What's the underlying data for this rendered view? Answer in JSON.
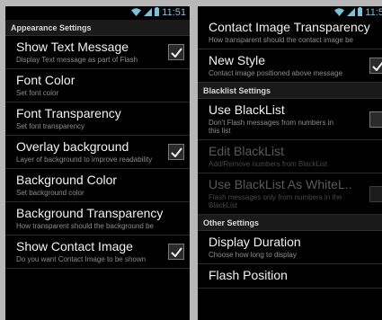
{
  "status_left": {
    "time": "11:51"
  },
  "status_right": {
    "time": "11:5"
  },
  "left_panel": {
    "section": "Appearance Settings",
    "prefs": [
      {
        "title": "Show Text Message",
        "summary": "Display Text message as part of Flash",
        "checked": true
      },
      {
        "title": "Font Color",
        "summary": "Set font color"
      },
      {
        "title": "Font Transparency",
        "summary": "Set font transparency"
      },
      {
        "title": "Overlay background",
        "summary": "Layer of background to improve readability",
        "checked": true
      },
      {
        "title": "Background Color",
        "summary": "Set background color"
      },
      {
        "title": "Background Transparency",
        "summary": "How transparent should the background be"
      },
      {
        "title": "Show Contact Image",
        "summary": "Do you want Contact Image to be shown",
        "checked": true
      }
    ]
  },
  "right_panel": {
    "top_pref": {
      "title": "Contact Image Transparency",
      "summary": "How transparent should the contact image be"
    },
    "new_style": {
      "title": "New Style",
      "summary": "Contact image positioned above message",
      "checked": true
    },
    "blacklist_section": "Blacklist Settings",
    "use_blacklist": {
      "title": "Use BlackList",
      "summary": "Don't Flash messages from numbers in this list",
      "checked": false
    },
    "edit_blacklist": {
      "title": "Edit BlackList",
      "summary": "Add/Remove numbers from BlackList"
    },
    "use_whitelist": {
      "title": "Use BlackList As WhiteL..",
      "summary": "Flash messages only from numbers in the BlackList",
      "checked": false
    },
    "other_section": "Other Settings",
    "display_duration": {
      "title": "Display Duration",
      "summary": "Choose how long to display"
    },
    "flash_position": {
      "title": "Flash Position"
    }
  }
}
